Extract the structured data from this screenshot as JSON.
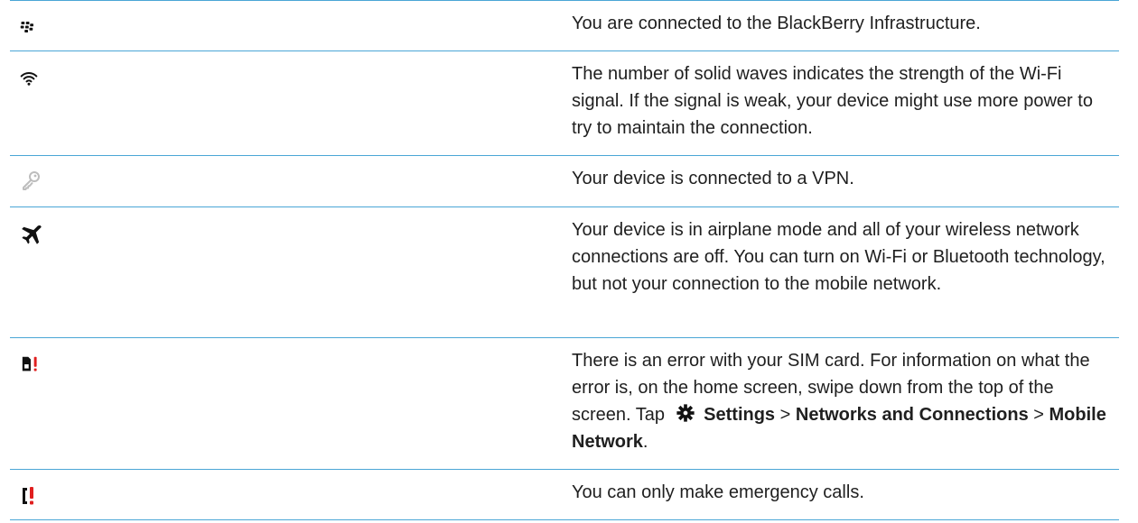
{
  "rows": [
    {
      "icon": "blackberry-logo-icon",
      "text": "You are connected to the BlackBerry Infrastructure."
    },
    {
      "icon": "wifi-signal-icon",
      "text": "The number of solid waves indicates the strength of the Wi-Fi signal. If the signal is weak, your device might use more power to try to maintain the connection."
    },
    {
      "icon": "vpn-key-icon",
      "text": "Your device is connected to a VPN."
    },
    {
      "icon": "airplane-icon",
      "text": "Your device is in airplane mode and all of your wireless network connections are off. You can turn on Wi-Fi or Bluetooth technology, but not your connection to the mobile network."
    },
    {
      "icon": "sim-card-error-icon",
      "text_before": "There is an error with your SIM card. For information on what the error is, on the home screen, swipe down from the top of the screen. Tap",
      "settings_label": "Settings",
      "sep1": ">",
      "networks_label": "Networks and Connections",
      "sep2": ">",
      "mobile_label": "Mobile Network",
      "end": "."
    },
    {
      "icon": "emergency-call-icon",
      "text": "You can only make emergency calls."
    }
  ],
  "colors": {
    "rule": "#4aa6d6",
    "error_red": "#e01f1f",
    "icon_dark": "#111111",
    "key_gray": "#bdbdbd"
  }
}
